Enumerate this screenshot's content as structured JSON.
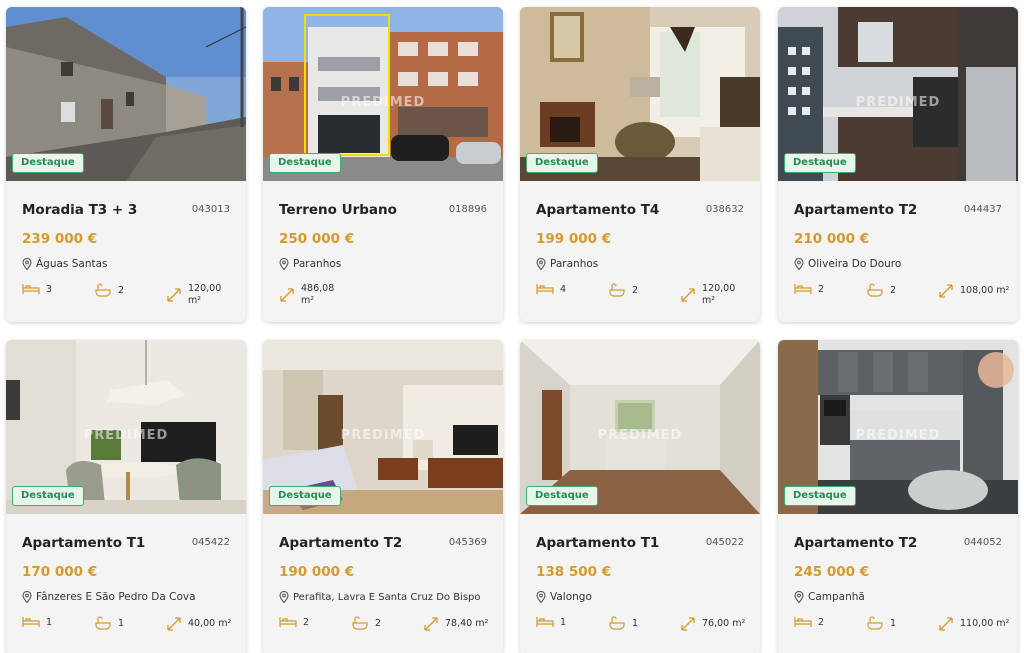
{
  "colors": {
    "price": "#d59a2c",
    "badge_border": "#3bb26a",
    "badge_text": "#2d8a52",
    "icon": "#d59a2c"
  },
  "watermark": "PREDIMED",
  "listings": [
    {
      "badge": "Destaque",
      "title": "Moradia T3 + 3",
      "ref": "043013",
      "price": "239 000 €",
      "location": "Águas Santas",
      "bedrooms": "3",
      "bathrooms": "2",
      "area": "120,00 m²",
      "icons": [
        "bed-icon",
        "bath-icon",
        "area-icon"
      ]
    },
    {
      "badge": "Destaque",
      "title": "Terreno Urbano",
      "ref": "018896",
      "price": "250 000 €",
      "location": "Paranhos",
      "bedrooms": "",
      "bathrooms": "",
      "area": "486,08 m²",
      "icons": [
        "area-icon"
      ]
    },
    {
      "badge": "Destaque",
      "title": "Apartamento T4",
      "ref": "038632",
      "price": "199 000 €",
      "location": "Paranhos",
      "bedrooms": "4",
      "bathrooms": "2",
      "area": "120,00 m²",
      "icons": [
        "bed-icon",
        "bath-icon",
        "area-icon"
      ]
    },
    {
      "badge": "Destaque",
      "title": "Apartamento T2",
      "ref": "044437",
      "price": "210 000 €",
      "location": "Oliveira Do Douro",
      "bedrooms": "2",
      "bathrooms": "2",
      "area": "108,00 m²",
      "icons": [
        "bed-icon",
        "bath-icon",
        "area-icon"
      ]
    },
    {
      "badge": "Destaque",
      "title": "Apartamento T1",
      "ref": "045422",
      "price": "170 000 €",
      "location": "Fânzeres E São Pedro Da Cova",
      "bedrooms": "1",
      "bathrooms": "1",
      "area": "40,00 m²",
      "icons": [
        "bed-icon",
        "bath-icon",
        "area-icon"
      ]
    },
    {
      "badge": "Destaque",
      "title": "Apartamento T2",
      "ref": "045369",
      "price": "190 000 €",
      "location": "Perafita, Lavra E Santa Cruz Do Bispo",
      "bedrooms": "2",
      "bathrooms": "2",
      "area": "78,40 m²",
      "icons": [
        "bed-icon",
        "bath-icon",
        "area-icon"
      ]
    },
    {
      "badge": "Destaque",
      "title": "Apartamento T1",
      "ref": "045022",
      "price": "138 500 €",
      "location": "Valongo",
      "bedrooms": "1",
      "bathrooms": "1",
      "area": "76,00 m²",
      "icons": [
        "bed-icon",
        "bath-icon",
        "area-icon"
      ]
    },
    {
      "badge": "Destaque",
      "title": "Apartamento T2",
      "ref": "044052",
      "price": "245 000 €",
      "location": "Campanhã",
      "bedrooms": "2",
      "bathrooms": "1",
      "area": "110,00 m²",
      "icons": [
        "bed-icon",
        "bath-icon",
        "area-icon"
      ]
    }
  ]
}
